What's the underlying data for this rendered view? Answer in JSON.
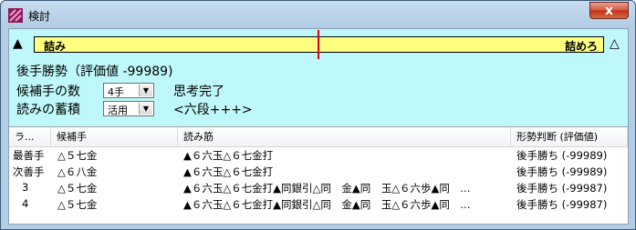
{
  "window": {
    "title": "検討",
    "close_label": "x"
  },
  "panel": {
    "side_left": "▲",
    "side_right": "△",
    "bar_left": "詰み",
    "bar_right": "詰めろ",
    "evaluation": "後手勝勢（評価値 -99989)",
    "candidates_label": "候補手の数",
    "candidates_value": "4手",
    "status": "思考完了",
    "accumulation_label": "読みの蓄積",
    "accumulation_value": "活用",
    "rank": "<六段+++>"
  },
  "table": {
    "headers": [
      "ラ...",
      "候補手",
      "読み筋",
      "形勢判断 (評価値)"
    ],
    "rows": [
      {
        "rank": "最善手",
        "move": "△５七金",
        "line": "▲６六玉△６七金打",
        "judgement": "後手勝ち (-99989)"
      },
      {
        "rank": "次善手",
        "move": "△６八金",
        "line": "▲６六玉△６七金打",
        "judgement": "後手勝ち (-99989)"
      },
      {
        "rank": "3",
        "move": "△５七金",
        "line": "▲６六玉△６七金打▲同銀引△同　金▲同　玉△６六歩▲同　...",
        "judgement": "後手勝ち (-99987)"
      },
      {
        "rank": "4",
        "move": "△５七金",
        "line": "▲６六玉△６七金打▲同銀引△同　金▲同　玉△６六歩▲同　...",
        "judgement": "後手勝ち (-99987)"
      }
    ]
  }
}
